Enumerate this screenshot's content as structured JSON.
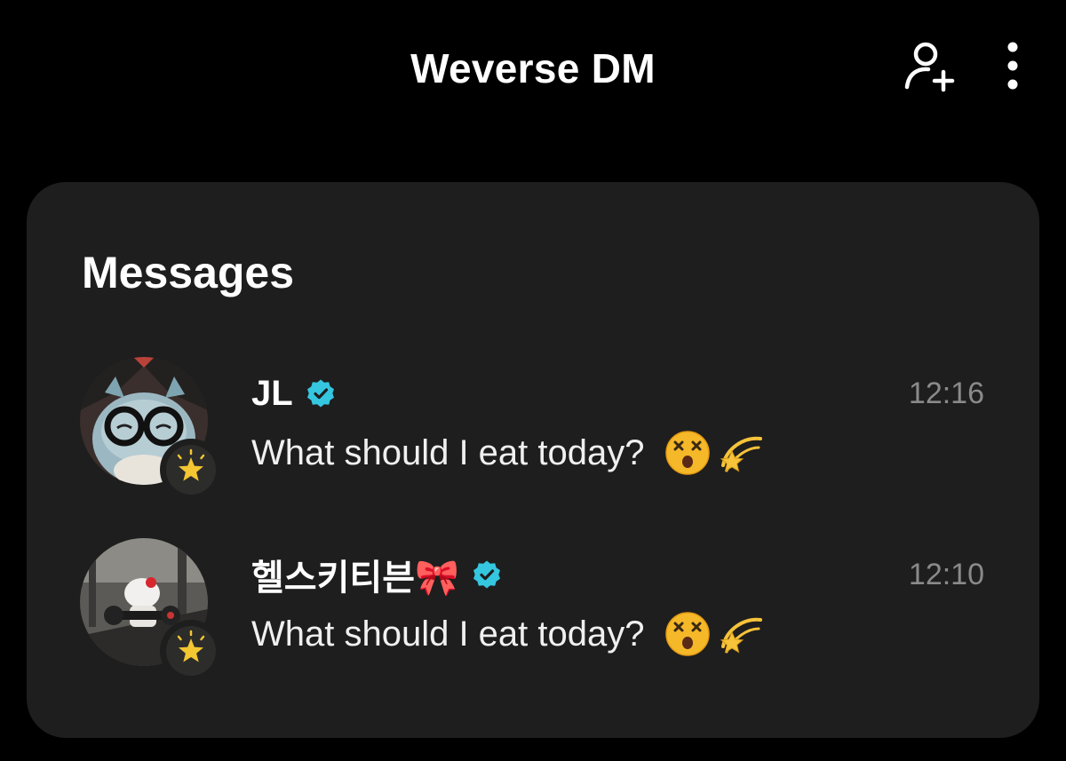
{
  "header": {
    "title": "Weverse DM",
    "add_user_icon": "add-user-icon",
    "more_icon": "more-vertical-icon"
  },
  "messages": {
    "title": "Messages",
    "conversations": [
      {
        "name": "JL",
        "verified": true,
        "time": "12:16",
        "preview": "What should I eat today?",
        "preview_emojis": [
          "dizzy-face-emoji",
          "dizzy-star-emoji"
        ],
        "avatar_badge_icon": "star-badge-icon"
      },
      {
        "name": "헬스키티븐🎀",
        "verified": true,
        "time": "12:10",
        "preview": "What should I eat today?",
        "preview_emojis": [
          "dizzy-face-emoji",
          "dizzy-star-emoji"
        ],
        "avatar_badge_icon": "star-badge-icon"
      }
    ]
  },
  "colors": {
    "background": "#000000",
    "card": "#1e1e1e",
    "text_primary": "#ffffff",
    "text_secondary": "#8a8a8a",
    "verified_accent": "#35c6e0",
    "badge_star": "#f3c632"
  }
}
